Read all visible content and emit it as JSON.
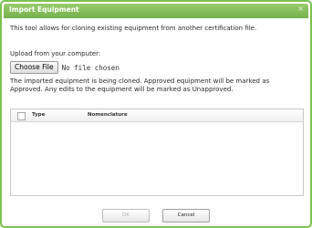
{
  "dialog": {
    "title": "Import Equipment",
    "close_glyph": "×",
    "intro": "This tool allows for cloning existing equipment from another certification file.",
    "upload_label": "Upload from your computer:",
    "file_button": "Choose File",
    "file_status": "No file chosen",
    "note": "The imported equipment is being cloned. Approved equipment will be marked as Approved. Any edits to the equipment will be marked as Unapproved."
  },
  "grid": {
    "columns": [
      "Type",
      "Nomenclature"
    ],
    "rows": []
  },
  "buttons": {
    "ok": "OK",
    "cancel": "Cancel"
  },
  "colors": {
    "accent": "#7cc24f",
    "titlebar": "#73b14c"
  },
  "icons": {
    "close": "close-icon",
    "select_all": "checkbox"
  }
}
